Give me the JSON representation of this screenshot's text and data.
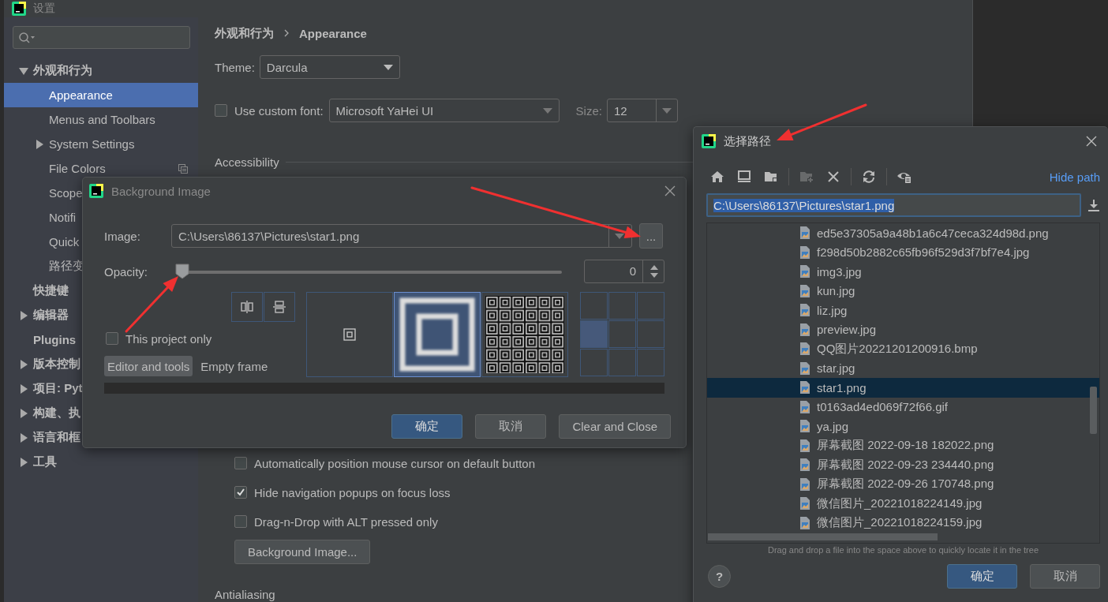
{
  "settings": {
    "title": "设置",
    "nav": [
      {
        "label": "外观和行为",
        "expanded": true,
        "selected": false,
        "children": [
          {
            "label": "Appearance",
            "selected": true,
            "project_level": false
          },
          {
            "label": "Menus and Toolbars",
            "selected": false,
            "project_level": false
          },
          {
            "label": "System Settings",
            "expanded": false,
            "selected": false,
            "project_level": false
          },
          {
            "label": "File Colors",
            "selected": false,
            "project_level": true
          },
          {
            "label": "Scope",
            "selected": false,
            "project_level": false
          },
          {
            "label": "Notifi",
            "selected": false,
            "project_level": false
          },
          {
            "label": "Quick",
            "selected": false,
            "project_level": false
          },
          {
            "label": "路径变",
            "selected": false,
            "project_level": false
          }
        ]
      },
      {
        "label": "快捷键",
        "selected": false
      },
      {
        "label": "编辑器",
        "expanded": false,
        "selected": false
      },
      {
        "label": "Plugins",
        "selected": false
      },
      {
        "label": "版本控制",
        "expanded": false,
        "selected": false
      },
      {
        "label": "项目: Pyt",
        "expanded": false,
        "selected": false
      },
      {
        "label": "构建、执",
        "expanded": false,
        "selected": false
      },
      {
        "label": "语言和框",
        "expanded": false,
        "selected": false
      },
      {
        "label": "工具",
        "expanded": false,
        "selected": false
      }
    ],
    "breadcrumb": [
      "外观和行为",
      "Appearance"
    ],
    "theme": {
      "label": "Theme:",
      "value": "Darcula"
    },
    "custom_font": {
      "label": "Use custom font:",
      "checked": false,
      "value": "Microsoft YaHei UI"
    },
    "size": {
      "label": "Size:",
      "value": "12"
    },
    "section": "Accessibility",
    "options": [
      {
        "label": "Automatically position mouse cursor on default button",
        "checked": false
      },
      {
        "label": "Hide navigation popups on focus loss",
        "checked": true
      },
      {
        "label": "Drag-n-Drop with ALT pressed only",
        "checked": false
      }
    ],
    "background_button": "Background Image...",
    "next_section": "Antialiasing"
  },
  "bg_dialog": {
    "title": "Background Image",
    "image": {
      "label": "Image:",
      "value": "C:\\Users\\86137\\Pictures\\star1.png",
      "browse": "..."
    },
    "opacity": {
      "label": "Opacity:",
      "level": 0,
      "value": "0"
    },
    "this_project_only": {
      "label": "This project only",
      "checked": false
    },
    "targets": [
      {
        "label": "Editor and tools",
        "selected": true
      },
      {
        "label": "Empty frame",
        "selected": false
      }
    ],
    "fill_modes": [
      {
        "kind": "center",
        "selected": false
      },
      {
        "kind": "scale",
        "selected": true
      },
      {
        "kind": "tile",
        "selected": false
      }
    ],
    "anchor_cells": [
      {
        "selected": false
      },
      {
        "selected": false
      },
      {
        "selected": false
      },
      {
        "selected": true
      },
      {
        "selected": false
      },
      {
        "selected": false
      },
      {
        "selected": false
      },
      {
        "selected": false
      },
      {
        "selected": false
      }
    ],
    "buttons": [
      {
        "label": "确定",
        "kind": "primary"
      },
      {
        "label": "取消",
        "kind": "normal"
      },
      {
        "label": "Clear and Close",
        "kind": "normal"
      }
    ]
  },
  "path_dialog": {
    "title": "选择路径",
    "tool_groups": [
      [
        {
          "kind": "home",
          "disabled": false
        },
        {
          "kind": "desktop",
          "disabled": false
        },
        {
          "kind": "project",
          "disabled": false
        }
      ],
      [
        {
          "kind": "new_folder",
          "disabled": true
        },
        {
          "kind": "delete",
          "disabled": false
        }
      ],
      [
        {
          "kind": "refresh",
          "disabled": false
        }
      ],
      [
        {
          "kind": "show_hidden",
          "disabled": false
        }
      ]
    ],
    "hide_path": "Hide path",
    "path": "C:\\Users\\86137\\Pictures\\star1.png",
    "files": [
      {
        "name": "ed5e37305a9a48b1a6c47ceca324d98d.png",
        "selected": false
      },
      {
        "name": "f298d50b2882c65fb96f529d3f7bf7e4.jpg",
        "selected": false
      },
      {
        "name": "img3.jpg",
        "selected": false
      },
      {
        "name": "kun.jpg",
        "selected": false
      },
      {
        "name": "liz.jpg",
        "selected": false
      },
      {
        "name": "preview.jpg",
        "selected": false
      },
      {
        "name": "QQ图片20221201200916.bmp",
        "selected": false
      },
      {
        "name": "star.jpg",
        "selected": false
      },
      {
        "name": "star1.png",
        "selected": true
      },
      {
        "name": "t0163ad4ed069f72f66.gif",
        "selected": false
      },
      {
        "name": "ya.jpg",
        "selected": false
      },
      {
        "name": "屏幕截图 2022-09-18 182022.png",
        "selected": false
      },
      {
        "name": "屏幕截图 2022-09-23 234440.png",
        "selected": false
      },
      {
        "name": "屏幕截图 2022-09-26 170748.png",
        "selected": false
      },
      {
        "name": "微信图片_20221018224149.jpg",
        "selected": false
      },
      {
        "name": "微信图片_20221018224159.jpg",
        "selected": false
      }
    ],
    "hint": "Drag and drop a file into the space above to quickly locate it in the tree",
    "help": "?",
    "buttons": [
      {
        "label": "确定",
        "kind": "primary"
      },
      {
        "label": "取消",
        "kind": "normal"
      }
    ]
  }
}
